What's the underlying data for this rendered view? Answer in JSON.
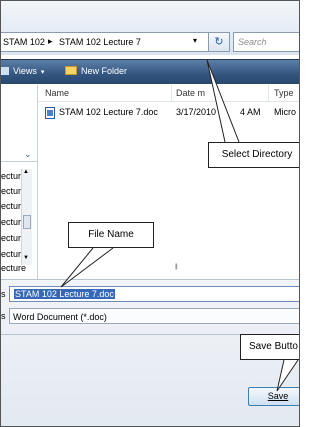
{
  "address_bar": {
    "crumbs": [
      "STAM 102",
      "STAM 102 Lecture 7"
    ],
    "separator": "▸",
    "dropdown_glyph": "▾",
    "refresh_glyph": "↻",
    "search_placeholder": "Search"
  },
  "toolbar": {
    "views_label": "Views",
    "views_chevron": "▾",
    "new_folder_label": "New Folder"
  },
  "left_pane": {
    "chevron": "⌄",
    "items": [
      "ecture",
      "ecture",
      "ecture",
      "ecture",
      "ecture",
      "ecture",
      "ecture"
    ],
    "scroll_up": "▲",
    "scroll_down": "▼"
  },
  "file_list": {
    "columns": [
      "Name",
      "Date modified",
      "Type"
    ],
    "column_visible_text": [
      "Name",
      "Date m",
      "Type"
    ],
    "rows": [
      {
        "name": "STAM 102 Lecture 7.doc",
        "date_visible": "3/17/2010",
        "time_visible": "4 AM",
        "type_visible": "Micro"
      }
    ],
    "h_scroll_grip": "|||"
  },
  "form": {
    "filename_label_visible": "s",
    "filename_value": "STAM 102 Lecture 7.doc",
    "type_label_visible": "s",
    "type_value": "Word Document (*.doc)"
  },
  "buttons": {
    "save_label": "Save"
  },
  "callouts": {
    "select_directory": "Select Directory",
    "file_name": "File Name",
    "save_button": "Save Butto"
  },
  "colors": {
    "toolbar": "#33557f",
    "selection": "#3668b8",
    "button_border": "#3c7fb1"
  }
}
